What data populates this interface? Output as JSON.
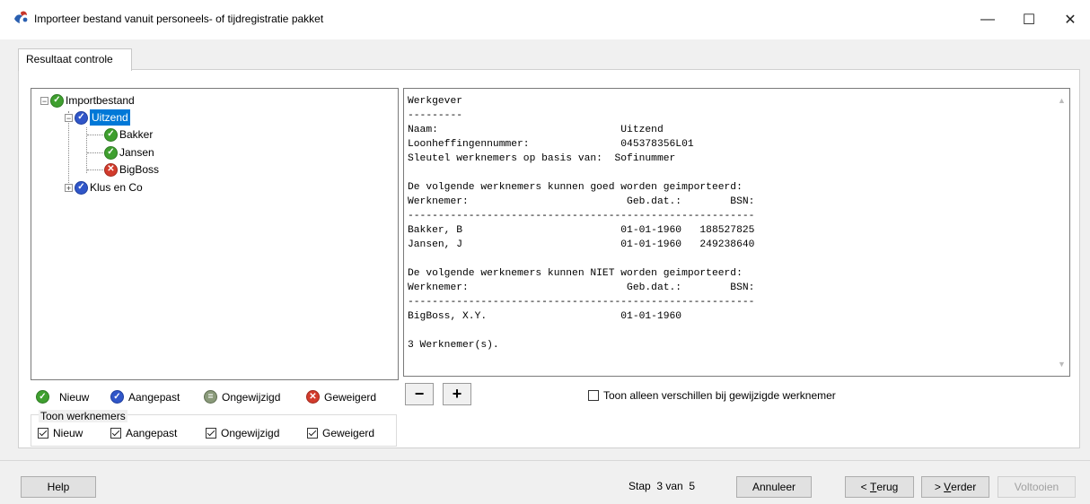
{
  "window": {
    "title": "Importeer bestand vanuit personeels- of tijdregistratie pakket",
    "minimize": "—",
    "maximize": "☐",
    "close": "✕"
  },
  "tabs": [
    {
      "label": "Resultaat controle"
    }
  ],
  "tree": {
    "root": {
      "label": "Importbestand",
      "status": "green"
    },
    "groups": [
      {
        "label": "Uitzend",
        "status": "blue",
        "expanded": true,
        "selected": true,
        "children": [
          {
            "label": "Bakker",
            "status": "green"
          },
          {
            "label": "Jansen",
            "status": "green"
          },
          {
            "label": "BigBoss",
            "status": "red"
          }
        ]
      },
      {
        "label": "Klus en Co",
        "status": "blue",
        "expanded": false
      }
    ]
  },
  "report_text": "Werkgever\n---------\nNaam:                              Uitzend\nLoonheffingennummer:               045378356L01\nSleutel werknemers op basis van:  Sofinummer\n\nDe volgende werknemers kunnen goed worden geimporteerd:\nWerknemer:                          Geb.dat.:        BSN:\n---------------------------------------------------------\nBakker, B                          01-01-1960   188527825\nJansen, J                          01-01-1960   249238640\n\nDe volgende werknemers kunnen NIET worden geimporteerd:\nWerknemer:                          Geb.dat.:        BSN:\n---------------------------------------------------------\nBigBoss, X.Y.                      01-01-1960\n\n3 Werknemer(s).",
  "legend": {
    "new": "Nieuw",
    "changed": "Aangepast",
    "unchanged": "Ongewijzigd",
    "rejected": "Geweigerd"
  },
  "show_employees": {
    "title": "Toon werknemers",
    "options": [
      {
        "label": "Nieuw",
        "checked": true
      },
      {
        "label": "Aangepast",
        "checked": true
      },
      {
        "label": "Ongewijzigd",
        "checked": true
      },
      {
        "label": "Geweigerd",
        "checked": true
      }
    ]
  },
  "zoom": {
    "minus": "−",
    "plus": "+"
  },
  "only_diff_checkbox": {
    "label": "Toon alleen verschillen bij gewijzigde werknemer",
    "checked": false
  },
  "footer": {
    "help": "Help",
    "step": "Stap  3 van  5",
    "cancel": "Annuleer",
    "back_prefix": "< ",
    "back_accel": "T",
    "back_rest": "erug",
    "next_prefix": "> ",
    "next_accel": "V",
    "next_rest": "erder",
    "finish": "Voltooien"
  },
  "colors": {
    "selection": "#0078d7",
    "new": "#3f9f2f",
    "changed": "#3056c8",
    "rejected": "#d23b2c"
  }
}
